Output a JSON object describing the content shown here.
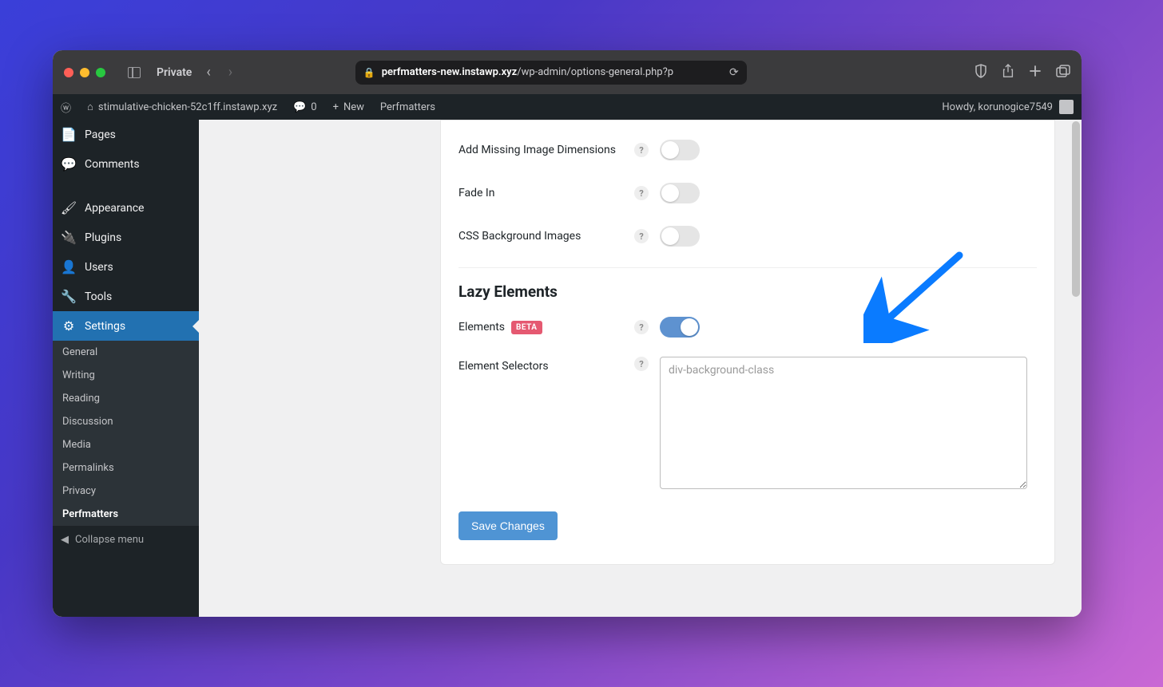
{
  "browser": {
    "private_label": "Private",
    "url_host": "perfmatters-new.instawp.xyz",
    "url_path": "/wp-admin/options-general.php?p"
  },
  "adminbar": {
    "site_name": "stimulative-chicken-52c1ff.instawp.xyz",
    "comment_count": "0",
    "new_label": "New",
    "plugin_label": "Perfmatters",
    "howdy": "Howdy, korunogice7549"
  },
  "sidebar": {
    "items": [
      {
        "label": "Pages",
        "icon": "📄"
      },
      {
        "label": "Comments",
        "icon": "💬"
      }
    ],
    "items2": [
      {
        "label": "Appearance",
        "icon": "🖌"
      },
      {
        "label": "Plugins",
        "icon": "🔌"
      },
      {
        "label": "Users",
        "icon": "👤"
      },
      {
        "label": "Tools",
        "icon": "🔧"
      },
      {
        "label": "Settings",
        "icon": "⚙"
      }
    ],
    "submenu": [
      "General",
      "Writing",
      "Reading",
      "Discussion",
      "Media",
      "Permalinks",
      "Privacy",
      "Perfmatters"
    ],
    "collapse": "Collapse menu"
  },
  "settings": {
    "rows": [
      {
        "label": "Add Missing Image Dimensions",
        "on": false
      },
      {
        "label": "Fade In",
        "on": false
      },
      {
        "label": "CSS Background Images",
        "on": false
      }
    ],
    "lazy_heading": "Lazy Elements",
    "elements_label": "Elements",
    "beta_text": "BETA",
    "elements_on": true,
    "selectors_label": "Element Selectors",
    "selectors_placeholder": "div-background-class",
    "save_button": "Save Changes",
    "help_char": "?"
  }
}
